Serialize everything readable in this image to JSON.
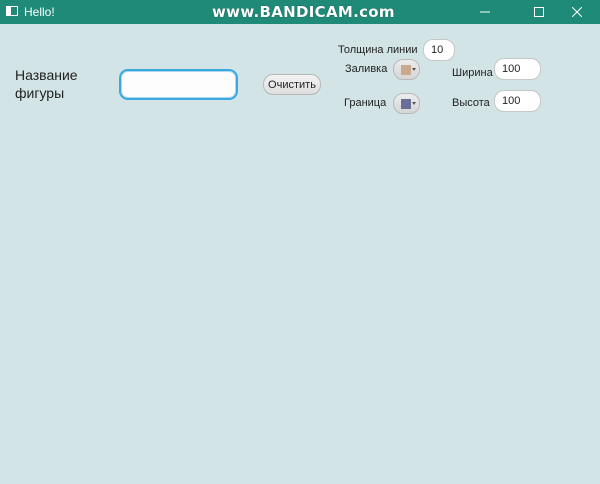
{
  "window": {
    "title": "Hello!",
    "watermark": "www.BANDICAM.com"
  },
  "form": {
    "shape_name_label": "Название фигуры",
    "shape_name_value": "",
    "clear_button": "Очистить",
    "line_thickness_label": "Толщина линии",
    "line_thickness_value": "10",
    "fill_label": "Заливка",
    "border_label": "Граница",
    "width_label": "Ширина",
    "width_value": "100",
    "height_label": "Высота",
    "height_value": "100"
  },
  "colors": {
    "fill_swatch": "#c9a98f",
    "border_swatch": "#6a6f9a",
    "background": "#d2e4e6",
    "titlebar": "#1f8a78",
    "focus": "#3da8e0"
  },
  "icons": {
    "app": "window-app-icon",
    "minimize": "minimize-icon",
    "maximize": "maximize-icon",
    "close": "close-icon"
  }
}
